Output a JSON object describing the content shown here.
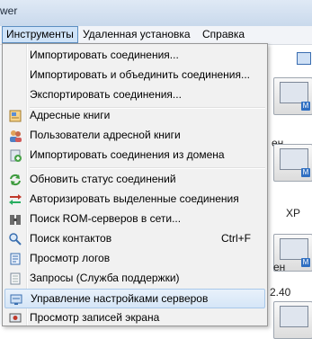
{
  "window": {
    "title_fragment": "wer"
  },
  "menubar": {
    "items": [
      {
        "label": "Инструменты",
        "active": true
      },
      {
        "label": "Удаленная установка",
        "active": false
      },
      {
        "label": "Справка",
        "active": false
      }
    ]
  },
  "tools_menu": {
    "items": [
      {
        "label": "Импортировать соединения...",
        "icon": "none"
      },
      {
        "label": "Импортировать и объединить соединения...",
        "icon": "none"
      },
      {
        "label": "Экспортировать соединения...",
        "icon": "none"
      },
      {
        "label": "Адресные книги",
        "icon": "address-book-icon"
      },
      {
        "label": "Пользователи адресной книги",
        "icon": "users-icon"
      },
      {
        "label": "Импортировать соединения из домена",
        "icon": "domain-import-icon"
      },
      {
        "label": "Обновить статус соединений",
        "icon": "refresh-icon"
      },
      {
        "label": "Авторизировать выделенные соединения",
        "icon": "authorize-icon"
      },
      {
        "label": "Поиск ROM-серверов в сети...",
        "icon": "server-search-icon"
      },
      {
        "label": "Поиск контактов",
        "icon": "magnifier-icon",
        "shortcut": "Ctrl+F"
      },
      {
        "label": "Просмотр логов",
        "icon": "log-icon"
      },
      {
        "label": "Запросы (Служба поддержки)",
        "icon": "support-icon"
      },
      {
        "label": "Управление настройками серверов",
        "icon": "server-settings-icon",
        "highlighted": true
      },
      {
        "label": "Просмотр записей экрана",
        "icon": "screen-record-icon"
      }
    ]
  },
  "background": {
    "labels": [
      "ен",
      "XP",
      "ен",
      "2.40"
    ],
    "badge_letter": "M"
  },
  "colors": {
    "menu_bg": "#f1f1f1",
    "highlight": "#d6e6f7",
    "highlight_border": "#a8c8ea",
    "menubar_active": "#cfe3f8"
  }
}
